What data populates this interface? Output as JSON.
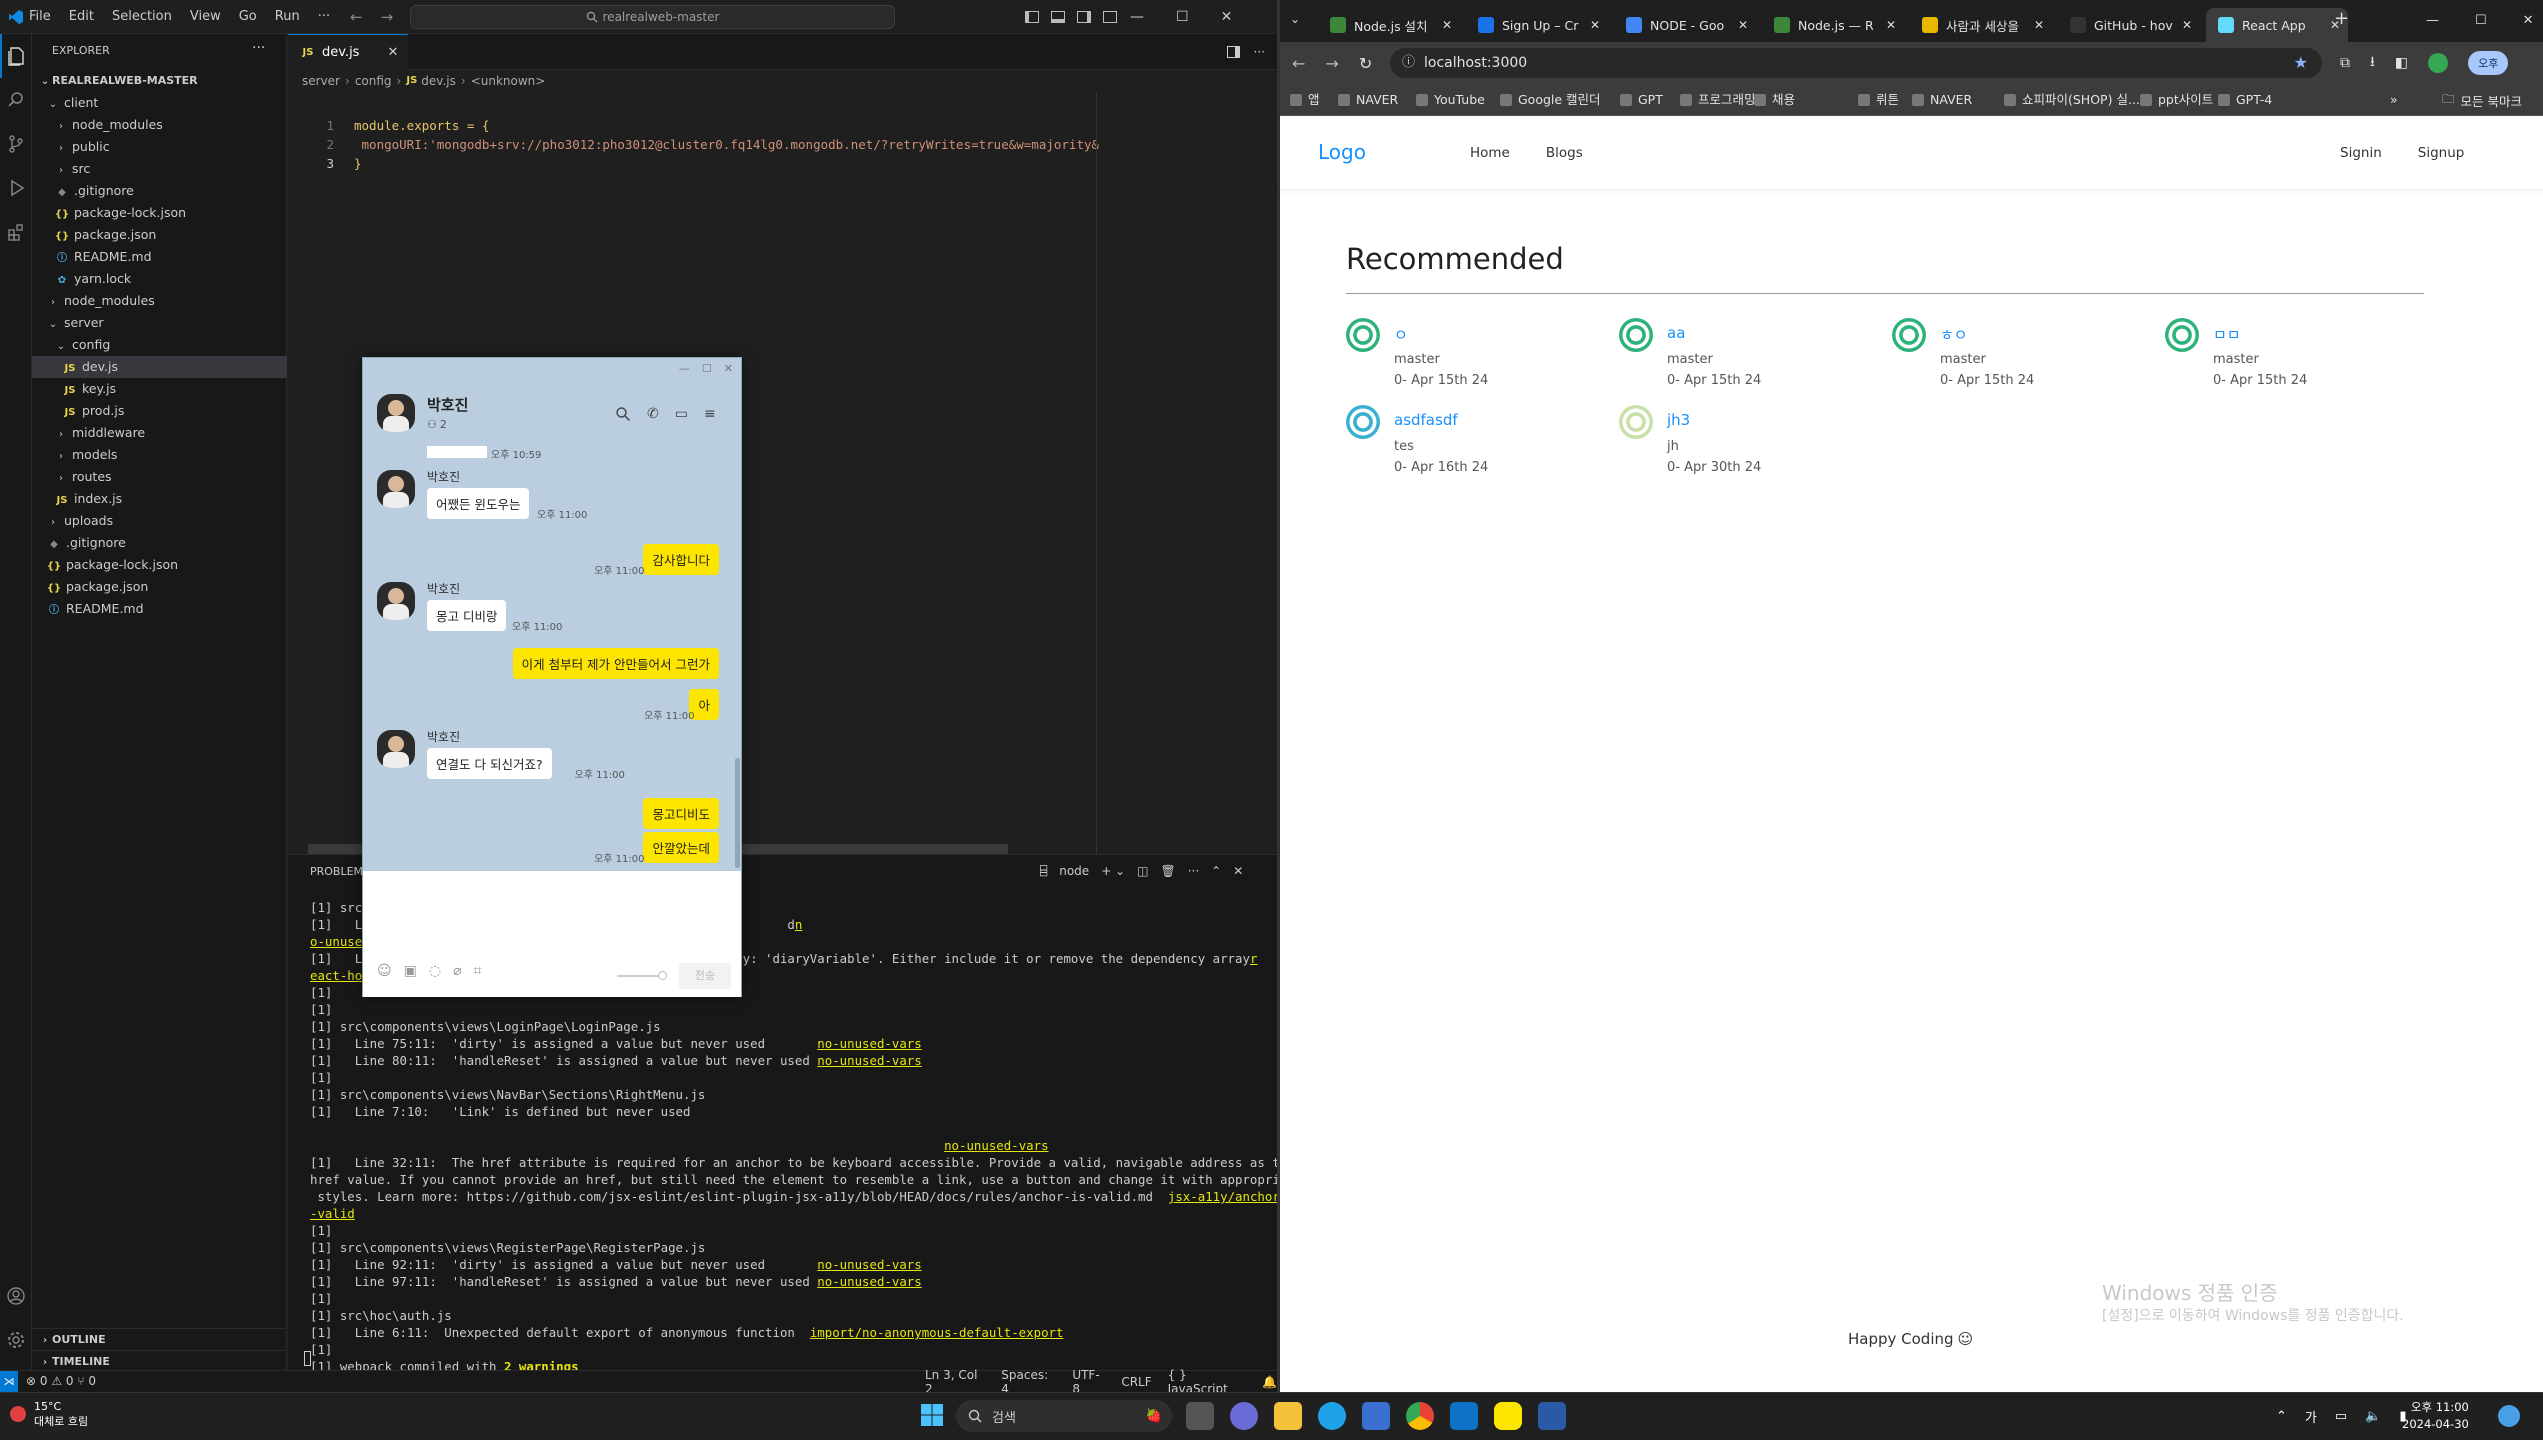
{
  "vscode": {
    "menu": [
      "File",
      "Edit",
      "Selection",
      "View",
      "Go",
      "Run",
      "···"
    ],
    "search": "realrealweb-master",
    "explorer_title": "EXPLORER",
    "root": "REALREALWEB-MASTER",
    "tree": [
      {
        "label": "client",
        "indent": 0,
        "type": "folder-open"
      },
      {
        "label": "node_modules",
        "indent": 1,
        "type": "folder"
      },
      {
        "label": "public",
        "indent": 1,
        "type": "folder"
      },
      {
        "label": "src",
        "indent": 1,
        "type": "folder"
      },
      {
        "label": ".gitignore",
        "indent": 1,
        "type": "file-git"
      },
      {
        "label": "package-lock.json",
        "indent": 1,
        "type": "file-json"
      },
      {
        "label": "package.json",
        "indent": 1,
        "type": "file-json"
      },
      {
        "label": "README.md",
        "indent": 1,
        "type": "file-info"
      },
      {
        "label": "yarn.lock",
        "indent": 1,
        "type": "file-yarn"
      },
      {
        "label": "node_modules",
        "indent": 0,
        "type": "folder"
      },
      {
        "label": "server",
        "indent": 0,
        "type": "folder-open"
      },
      {
        "label": "config",
        "indent": 1,
        "type": "folder-open"
      },
      {
        "label": "dev.js",
        "indent": 2,
        "type": "file-js",
        "selected": true
      },
      {
        "label": "key.js",
        "indent": 2,
        "type": "file-js"
      },
      {
        "label": "prod.js",
        "indent": 2,
        "type": "file-js"
      },
      {
        "label": "middleware",
        "indent": 1,
        "type": "folder"
      },
      {
        "label": "models",
        "indent": 1,
        "type": "folder"
      },
      {
        "label": "routes",
        "indent": 1,
        "type": "folder"
      },
      {
        "label": "index.js",
        "indent": 1,
        "type": "file-js"
      },
      {
        "label": "uploads",
        "indent": 0,
        "type": "folder"
      },
      {
        "label": ".gitignore",
        "indent": 0,
        "type": "file-git"
      },
      {
        "label": "package-lock.json",
        "indent": 0,
        "type": "file-json"
      },
      {
        "label": "package.json",
        "indent": 0,
        "type": "file-json"
      },
      {
        "label": "README.md",
        "indent": 0,
        "type": "file-info"
      }
    ],
    "outline": "OUTLINE",
    "timeline": "TIMELINE",
    "tab_label": "dev.js",
    "breadcrumb": [
      "server",
      "config",
      "dev.js",
      "<unknown>"
    ],
    "code": [
      {
        "n": "1",
        "text": "module.exports = {"
      },
      {
        "n": "2",
        "text": "    mongoURI:'mongodb+srv://pho3012:pho3012@cluster0.fq14lg0.mongodb.net/?retryWrites=true&w=majority&"
      },
      {
        "n": "3",
        "text": "}"
      }
    ],
    "panel_tab": "PROBLEMS",
    "terminal_label": "node",
    "terminal": [
      {
        "text": "[1] src\\"
      },
      {
        "text": "[1]   Li                                                        d",
        "link": "n"
      },
      {
        "text": "o-unused",
        "link_only": true
      },
      {
        "text": "[1]   Li                                                  y: 'diaryVariable'. Either include it or remove the dependency array",
        "link": "r"
      },
      {
        "text": "eact-hoo",
        "link_only": true
      },
      {
        "text": "[1]"
      },
      {
        "text": "[1]"
      },
      {
        "text": "[1] src\\components\\views\\LoginPage\\LoginPage.js"
      },
      {
        "text": "[1]   Line 75:11:  'dirty' is assigned a value but never used       ",
        "link": "no-unused-vars"
      },
      {
        "text": "[1]   Line 80:11:  'handleReset' is assigned a value but never used ",
        "link": "no-unused-vars"
      },
      {
        "text": "[1]"
      },
      {
        "text": "[1] src\\components\\views\\NavBar\\Sections\\RightMenu.js"
      },
      {
        "text": "[1]   Line 7:10:   'Link' is defined but never used"
      },
      {
        "text": ""
      },
      {
        "text": "                                                                                     ",
        "link": "no-unused-vars"
      },
      {
        "text": "[1]   Line 32:11:  The href attribute is required for an anchor to be keyboard accessible. Provide a valid, navigable address as the"
      },
      {
        "text": "href value. If you cannot provide an href, but still need the element to resemble a link, use a button and change it with appropriate"
      },
      {
        "text": " styles. Learn more: https://github.com/jsx-eslint/eslint-plugin-jsx-a11y/blob/HEAD/docs/rules/anchor-is-valid.md  ",
        "link": "jsx-a11y/anchor-is"
      },
      {
        "text": "-valid",
        "link_only": true
      },
      {
        "text": "[1]"
      },
      {
        "text": "[1] src\\components\\views\\RegisterPage\\RegisterPage.js"
      },
      {
        "text": "[1]   Line 92:11:  'dirty' is assigned a value but never used       ",
        "link": "no-unused-vars"
      },
      {
        "text": "[1]   Line 97:11:  'handleReset' is assigned a value but never used ",
        "link": "no-unused-vars"
      },
      {
        "text": "[1]"
      },
      {
        "text": "[1] src\\hoc\\auth.js"
      },
      {
        "text": "[1]   Line 6:11:  Unexpected default export of anonymous function  ",
        "link": "import/no-anonymous-default-export"
      },
      {
        "text": "[1]"
      },
      {
        "text": "[1] webpack compiled with ",
        "bold_warn": "2 warnings"
      }
    ],
    "status": {
      "left": "⊗ 0 ⚠ 0   ⑂ 0",
      "position": "Ln 3, Col 2",
      "spaces": "Spaces: 4",
      "encoding": "UTF-8",
      "eol": "CRLF",
      "lang": "{ } JavaScript"
    }
  },
  "kakao": {
    "name": "박호진",
    "members": "2",
    "messages": [
      {
        "type": "sys",
        "time": "오후 10:59"
      },
      {
        "type": "in",
        "sender": "박호진",
        "text": "어쨌든 윈도우는",
        "time": "오후 11:00"
      },
      {
        "type": "out",
        "text": "감사합니다",
        "time": "오후 11:00"
      },
      {
        "type": "in",
        "sender": "박호진",
        "text": "몽고 디비랑",
        "time": "오후 11:00"
      },
      {
        "type": "out",
        "text": "이게 첨부터 제가 안만들어서 그런가",
        "time": ""
      },
      {
        "type": "out",
        "text": "아",
        "time": "오후 11:00"
      },
      {
        "type": "in",
        "sender": "박호진",
        "text": "연결도 다 되신거죠?",
        "time": "오후 11:00"
      },
      {
        "type": "out",
        "text": "몽고디비도",
        "time": ""
      },
      {
        "type": "out",
        "text": "안깔았는데",
        "time": "오후 11:00"
      }
    ],
    "send": "전송"
  },
  "chrome": {
    "tabs": [
      {
        "label": "Node.js 설치",
        "color": "#3c873a"
      },
      {
        "label": "Sign Up – Cr",
        "color": "#1a73e8"
      },
      {
        "label": "NODE - Goo",
        "color": "#4285f4"
      },
      {
        "label": "Node.js — R",
        "color": "#3c873a"
      },
      {
        "label": "사람과 세상을",
        "color": "#e6b800"
      },
      {
        "label": "GitHub - hov",
        "color": "#333333"
      },
      {
        "label": "React App",
        "color": "#61dafb",
        "active": true
      }
    ],
    "url": "localhost:3000",
    "bookmarks": [
      "앱",
      "NAVER",
      "YouTube",
      "Google 캘린더",
      "GPT",
      "프로그래밍",
      "채용",
      "뤼튼",
      "NAVER",
      "쇼피파이(SHOP) 실...",
      "ppt사이트",
      "GPT-4"
    ],
    "all_bookmarks": "모든 북마크",
    "profile": "오후"
  },
  "site": {
    "logo": "Logo",
    "nav_left": [
      "Home",
      "Blogs"
    ],
    "nav_right": [
      "Signin",
      "Signup"
    ],
    "heading": "Recommended",
    "cards": [
      {
        "title": "ㅇ",
        "writer": "master",
        "date": "0- Apr 15th 24",
        "color": "#2db37a"
      },
      {
        "title": "aa",
        "writer": "master",
        "date": "0- Apr 15th 24",
        "color": "#2db37a"
      },
      {
        "title": "ㅎㅇ",
        "writer": "master",
        "date": "0- Apr 15th 24",
        "color": "#2db37a"
      },
      {
        "title": "ㅁㅁ",
        "writer": "master",
        "date": "0- Apr 15th 24",
        "color": "#2db37a"
      },
      {
        "title": "asdfasdf",
        "writer": "tes",
        "date": "0- Apr 16th 24",
        "color": "#3ab0d0"
      },
      {
        "title": "jh3",
        "writer": "jh",
        "date": "0- Apr 30th 24",
        "color": "#c8e0a8"
      }
    ],
    "footer": "Happy Coding",
    "watermark_title": "Windows 정품 인증",
    "watermark_sub": "[설정]으로 이동하여 Windows를 정품 인증합니다."
  },
  "taskbar": {
    "weather_temp": "15°C",
    "weather_desc": "대체로 흐림",
    "search": "검색",
    "ime": "가",
    "time": "오후 11:00",
    "date": "2024-04-30"
  }
}
